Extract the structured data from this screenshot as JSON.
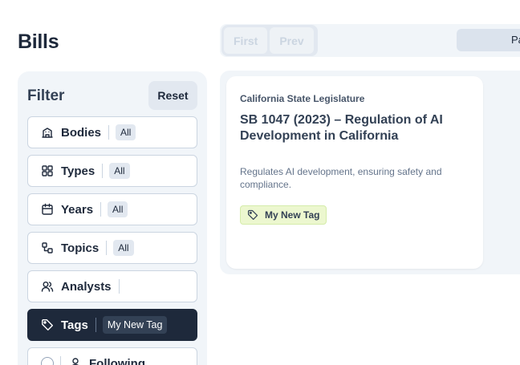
{
  "page": {
    "title": "Bills"
  },
  "filter": {
    "title": "Filter",
    "reset_label": "Reset",
    "items": [
      {
        "icon": "building-icon",
        "label": "Bodies",
        "value": "All"
      },
      {
        "icon": "grid-icon",
        "label": "Types",
        "value": "All"
      },
      {
        "icon": "calendar-icon",
        "label": "Years",
        "value": "All"
      },
      {
        "icon": "topics-icon",
        "label": "Topics",
        "value": "All"
      },
      {
        "icon": "users-icon",
        "label": "Analysts",
        "value": ""
      },
      {
        "icon": "tag-icon",
        "label": "Tags",
        "value": "My New Tag",
        "active": true
      },
      {
        "icon": "user-icon",
        "label": "Following",
        "value": ""
      }
    ]
  },
  "pagination": {
    "first_label": "First",
    "prev_label": "Prev",
    "page_label": "Pa"
  },
  "bill": {
    "source": "California State Legislature",
    "title": "SB 1047 (2023) – Regulation of AI Development in California",
    "summary": "Regulates AI development, ensuring safety and compliance.",
    "tag": "My New Tag",
    "tag_color": "#ecf7cf"
  }
}
